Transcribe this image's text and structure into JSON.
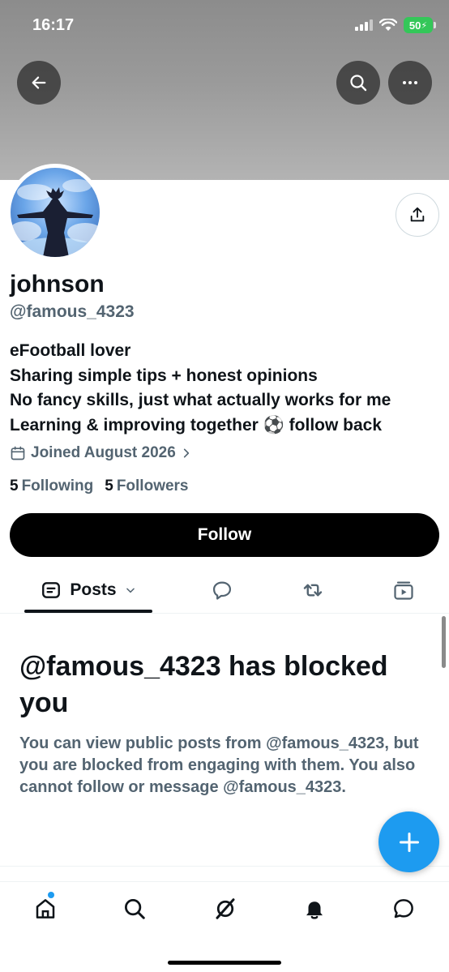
{
  "status_bar": {
    "time": "16:17",
    "battery": "50"
  },
  "profile": {
    "name": "johnson",
    "handle": "@famous_4323",
    "bio": [
      "eFootball lover",
      "Sharing simple tips + honest opinions",
      "No fancy skills, just what actually works for me",
      "Learning & improving together ⚽ follow back"
    ],
    "joined": "Joined August 2026",
    "following_count": "5",
    "following_label": "Following",
    "followers_count": "5",
    "followers_label": "Followers",
    "follow_button": "Follow"
  },
  "tabs": {
    "posts_label": "Posts"
  },
  "blocked": {
    "title": "@famous_4323 has blocked you",
    "message": "You can view public posts from @famous_4323, but you are blocked from engaging with them. You also cannot follow or message @famous_4323."
  },
  "colors": {
    "accent": "#1d9bf0",
    "text": "#0f1419",
    "secondary": "#536471",
    "battery": "#34c759"
  },
  "icons": {
    "back": "arrow-left-icon",
    "search": "search-icon",
    "more": "more-horizontal-icon",
    "share": "share-icon",
    "calendar": "calendar-icon",
    "chevron": "chevron-right-icon",
    "posts_tab": "posts-icon",
    "replies_tab": "reply-icon",
    "reposts_tab": "repost-icon",
    "media_tab": "media-icon",
    "compose": "plus-icon",
    "home": "home-icon",
    "explore": "search-icon",
    "grok": "grok-icon",
    "notifications": "bell-icon",
    "messages": "chat-icon"
  }
}
